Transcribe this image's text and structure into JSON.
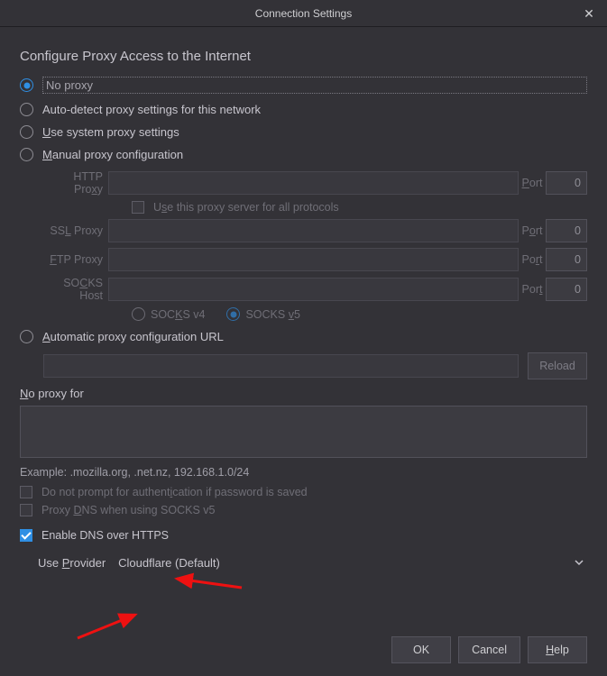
{
  "titlebar": {
    "title": "Connection Settings",
    "close_glyph": "✕"
  },
  "heading": "Configure Proxy Access to the Internet",
  "radios": {
    "no_proxy": "No proxy",
    "auto_detect": "Auto-detect proxy settings for this network",
    "use_system_pre": "U",
    "use_system_post": "se system proxy settings",
    "manual_pre": "M",
    "manual_post": "anual proxy configuration",
    "auto_url_pre": "A",
    "auto_url_post": "utomatic proxy configuration URL"
  },
  "proxy": {
    "http_pre": "HTTP Pro",
    "http_u": "x",
    "http_post": "y",
    "http_value": "",
    "http_port": "0",
    "port_u": "P",
    "port_post": "ort",
    "use_all_pre": "U",
    "use_all_u": "s",
    "use_all_post": "e this proxy server for all protocols",
    "ssl_pre": "SS",
    "ssl_u": "L",
    "ssl_post": " Proxy",
    "ssl_value": "",
    "ssl_port": "0",
    "ssl_port_u": "o",
    "ftp_pre": "",
    "ftp_u": "F",
    "ftp_post": "TP Proxy",
    "ftp_value": "",
    "ftp_port": "0",
    "socks_pre": "SO",
    "socks_u": "C",
    "socks_post": "KS Host",
    "socks_value": "",
    "socks_port": "0",
    "socks_port_u": "t",
    "socks4_pre": "SOC",
    "socks4_u": "K",
    "socks4_post": "S v4",
    "socks5_pre": "SOCKS ",
    "socks5_u": "v",
    "socks5_post": "5"
  },
  "reload_pre": "R",
  "reload_u": "e",
  "reload_post": "load",
  "no_proxy_for_pre": "N",
  "no_proxy_for_post": "o proxy for",
  "no_proxy_value": "",
  "example": "Example: .mozilla.org, .net.nz, 192.168.1.0/24",
  "checks": {
    "no_prompt_pre": "Do not prompt for authent",
    "no_prompt_u": "i",
    "no_prompt_post": "cation if password is saved",
    "proxy_dns_pre": "Proxy ",
    "proxy_dns_u": "D",
    "proxy_dns_post": "NS when using SOCKS v5",
    "enable_doh": "Enable DNS over HTTPS"
  },
  "provider_label_pre": "Use ",
  "provider_label_u": "P",
  "provider_label_post": "rovider",
  "provider_value": "Cloudflare (Default)",
  "buttons": {
    "ok": "OK",
    "cancel": "Cancel",
    "help_u": "H",
    "help_post": "elp"
  }
}
